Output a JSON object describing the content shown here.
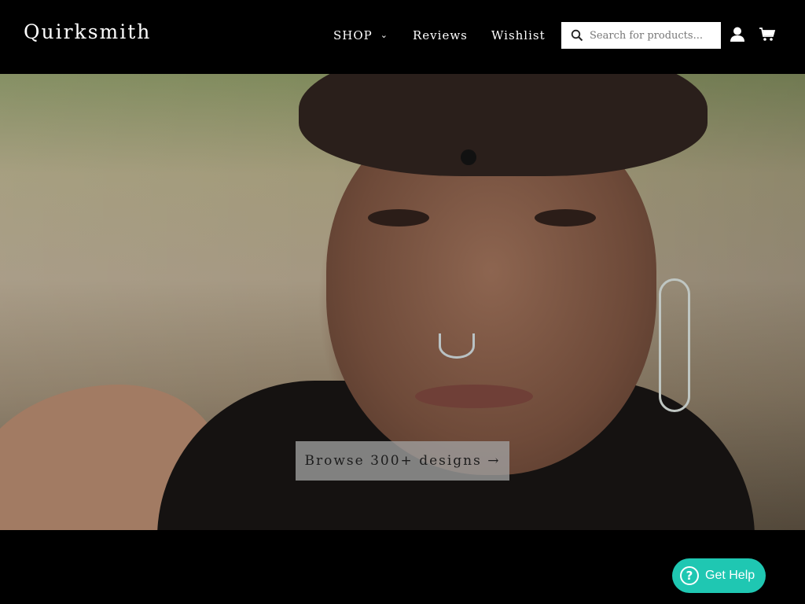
{
  "header": {
    "logo": "Quirksmith",
    "nav": {
      "shop": "SHOP",
      "reviews": "Reviews",
      "wishlist": "Wishlist"
    },
    "search": {
      "placeholder": "Search for products..."
    },
    "icons": [
      "search-icon",
      "account-icon",
      "cart-icon",
      "chevron-down-icon"
    ]
  },
  "hero": {
    "cta_label": "Browse 300+ designs →"
  },
  "help": {
    "label": "Get Help",
    "icon": "?"
  },
  "colors": {
    "header_bg": "#000000",
    "help_bg": "#1fc7b2",
    "cta_bg": "#a0a0a0"
  }
}
